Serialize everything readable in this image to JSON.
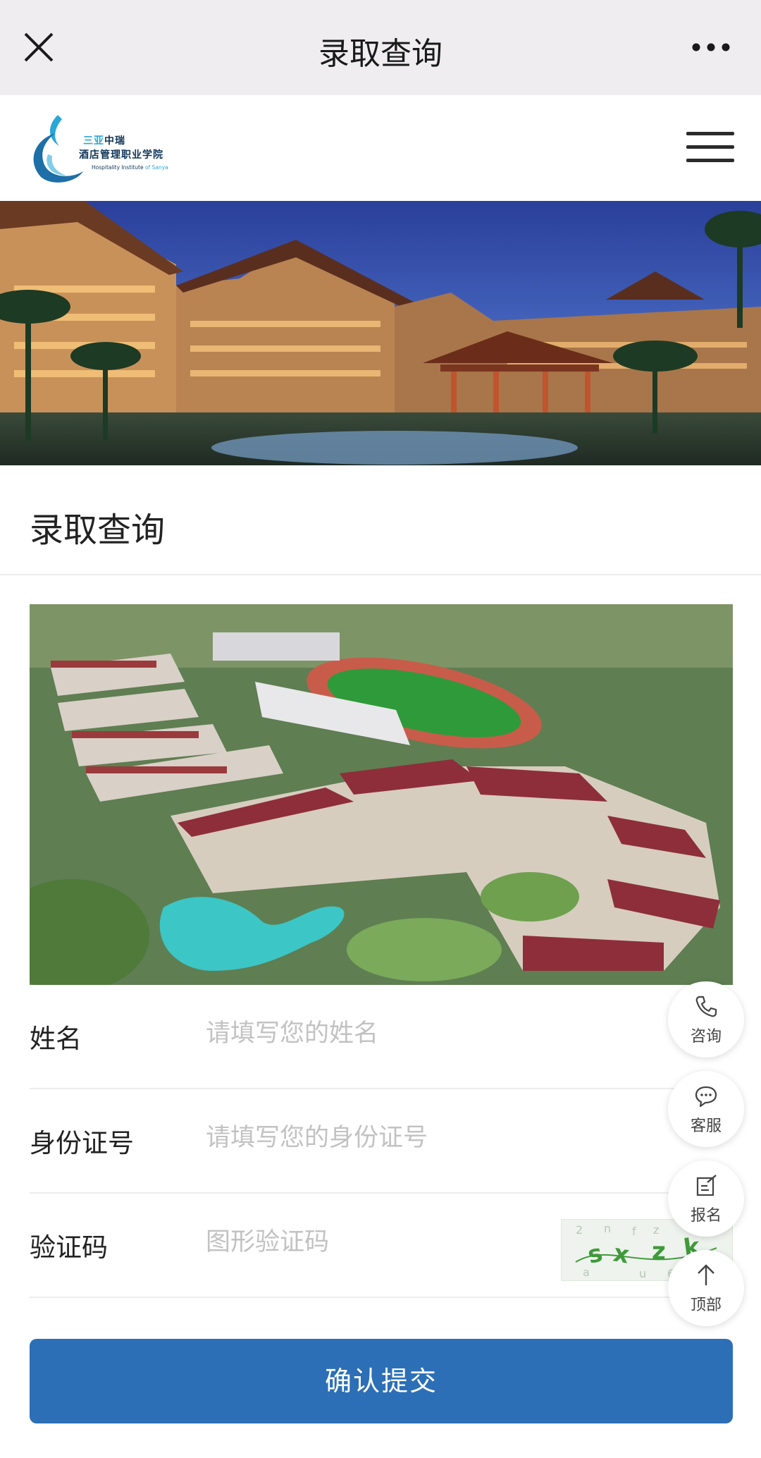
{
  "topbar": {
    "title": "录取查询",
    "close_icon": "close-icon",
    "more_icon": "more-icon"
  },
  "header": {
    "logo_line1_a": "三亚",
    "logo_line1_b": "中瑞",
    "logo_line2": "酒店管理职业学院",
    "logo_en_a": "Hospitality Institute",
    "logo_en_b": "of Sanya",
    "menu_icon": "hamburger-icon"
  },
  "section": {
    "heading": "录取查询"
  },
  "form": {
    "name_label": "姓名",
    "name_placeholder": "请填写您的姓名",
    "id_label": "身份证号",
    "id_placeholder": "请填写您的身份证号",
    "captcha_label": "验证码",
    "captcha_placeholder": "图形验证码",
    "submit_label": "确认提交"
  },
  "floating": {
    "consult": "咨询",
    "service": "客服",
    "signup": "报名",
    "top": "顶部"
  },
  "colors": {
    "submit_bg": "#2c6fb6",
    "topbar_bg": "#efedf0",
    "logo_blue": "#2aa7d8"
  }
}
